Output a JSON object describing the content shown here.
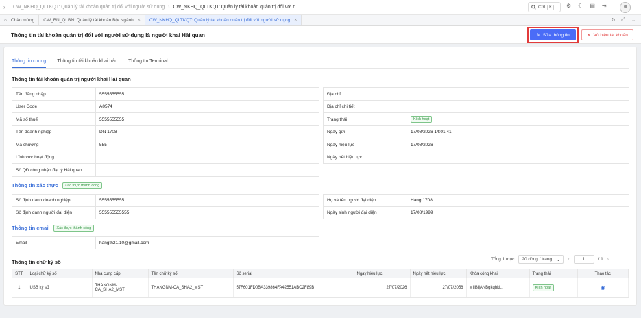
{
  "topbar": {
    "breadcrumbs": [
      "CW_NKHQ_QLTKQT: Quản lý tài khoản quản trị đối với người sử dụng",
      "CW_NKHQ_QLTKQT: Quản lý tài khoản quản trị đối với n..."
    ],
    "search_label": "Ctrl",
    "search_key": "K"
  },
  "tabs": [
    {
      "label": "Chào mừng"
    },
    {
      "label": "CW_BN_QLBN: Quản lý tài khoản Bộ/ Ngành"
    },
    {
      "label": "CW_NKHQ_QLTKQT: Quản lý tài khoản quản trị đối với người sử dụng"
    }
  ],
  "page": {
    "title": "Thông tin tài khoản quản trị đối với người sử dụng là người khai Hải quan",
    "edit_button": "Sửa thông tin",
    "disable_button": "Vô hiệu tài khoản"
  },
  "subtabs": [
    "Thông tin chung",
    "Thông tin tài khoản khai báo",
    "Thông tin Terminal"
  ],
  "section_main": {
    "title": "Thông tin tài khoản quản trị người khai Hải quan",
    "left": [
      {
        "label": "Tên đăng nhập",
        "value": "5555555555"
      },
      {
        "label": "User Code",
        "value": "A0574"
      },
      {
        "label": "Mã số thuế",
        "value": "5555555555"
      },
      {
        "label": "Tên doanh nghiệp",
        "value": "DN 1708"
      },
      {
        "label": "Mã chương",
        "value": "555"
      },
      {
        "label": "Lĩnh vực hoạt động",
        "value": ""
      },
      {
        "label": "Số QĐ công nhận đại lý Hải quan",
        "value": ""
      }
    ],
    "right": [
      {
        "label": "Địa chỉ",
        "value": ""
      },
      {
        "label": "Địa chỉ chi tiết",
        "value": ""
      },
      {
        "label": "Trạng thái",
        "value": "Kích hoạt"
      },
      {
        "label": "Ngày gửi",
        "value": "17/08/2026 14:01:41"
      },
      {
        "label": "Ngày hiệu lực",
        "value": "17/08/2026"
      },
      {
        "label": "Ngày hết hiệu lực",
        "value": ""
      }
    ]
  },
  "section_verify": {
    "title": "Thông tin xác thực",
    "badge": "Xác thực thành công",
    "left": [
      {
        "label": "Số định danh doanh nghiệp",
        "value": "5555555555"
      },
      {
        "label": "Số định danh người đại diện",
        "value": "555555555555"
      }
    ],
    "right": [
      {
        "label": "Họ và tên người đại diện",
        "value": "Hang 1708"
      },
      {
        "label": "Ngày sinh người đại diện",
        "value": "17/08/1999"
      }
    ]
  },
  "section_email": {
    "title": "Thông tin email",
    "badge": "Xác thực thành công",
    "rows": [
      {
        "label": "Email",
        "value": "hangth21.10@gmail.com"
      }
    ]
  },
  "section_sig": {
    "title": "Thông tin chữ ký số",
    "total": "Tổng 1 mục",
    "page_size": "20 dòng / trang",
    "page": "1",
    "page_of": "/ 1",
    "columns": [
      "STT",
      "Loại chữ ký số",
      "Nhà cung cấp",
      "Tên chữ ký số",
      "Số serial",
      "Ngày hiệu lực",
      "Ngày hết hiệu lực",
      "Khóa công khai",
      "Trạng thái",
      "Thao tác"
    ],
    "rows": [
      {
        "stt": "1",
        "type": "USB ký số",
        "provider": "THANGNM-CA_SHA2_MST",
        "name": "THANGNM-CA_SHA2_MST",
        "serial": "57F601FD0BA339864FA42551ABC2F89B",
        "from": "27/07/2026",
        "to": "27/07/2056",
        "key": "MIIBIjANBgkqhki...",
        "status": "Kích hoạt"
      }
    ]
  },
  "colors": {
    "accent": "#4a6cf7",
    "danger": "#e23b3b",
    "success": "#3a9a4a"
  }
}
